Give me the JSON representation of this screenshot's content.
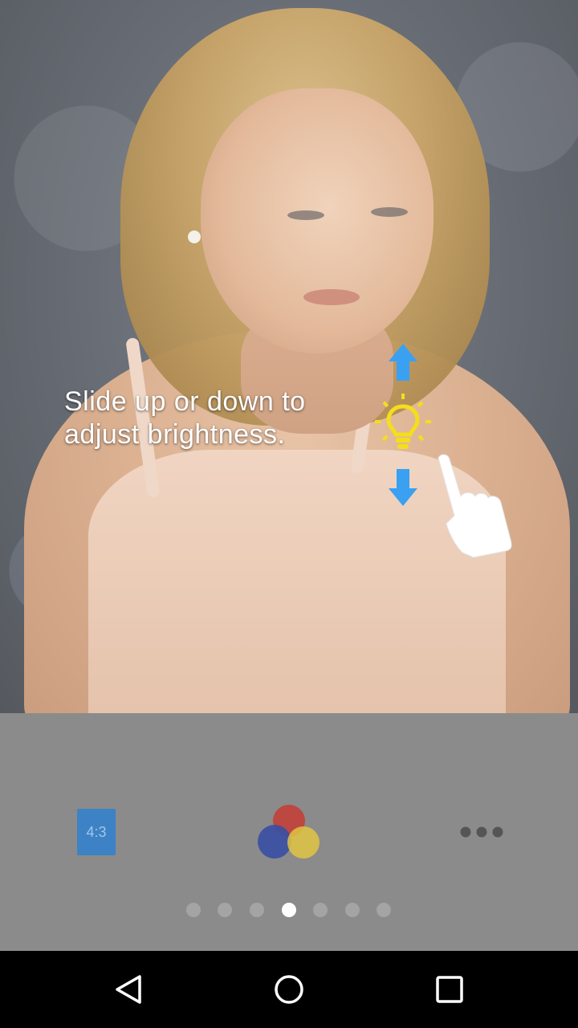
{
  "hint": {
    "line1": "Slide up or down to",
    "line2": "adjust brightness."
  },
  "toolbar": {
    "ratio_label": "4:3",
    "colors_icon": "color-circles-icon",
    "more_icon": "more-dots-icon"
  },
  "pager": {
    "total": 7,
    "active_index": 3
  },
  "navbar": {
    "back_icon": "back-triangle-icon",
    "home_icon": "home-circle-icon",
    "recents_icon": "recents-square-icon"
  },
  "colors": {
    "arrow_blue": "#3aa0f2",
    "bulb_yellow": "#f5de1b",
    "ratio_blue": "#3d82c4",
    "panel_gray": "#8b8b8b"
  }
}
